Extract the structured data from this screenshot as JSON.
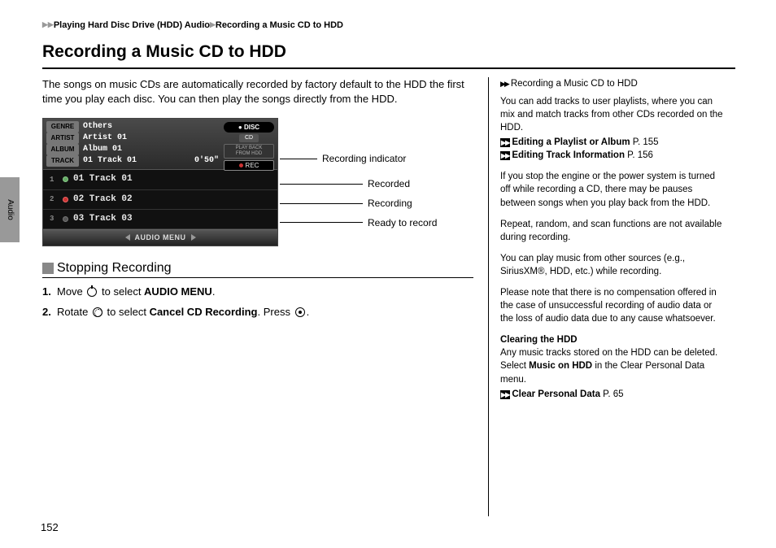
{
  "breadcrumb": {
    "part1": "Playing Hard Disc Drive (HDD) Audio",
    "part2": "Recording a Music CD to HDD"
  },
  "title": "Recording a Music CD to HDD",
  "intro": "The songs on music CDs are automatically recorded by factory default to the HDD the first time you play each disc. You can then play the songs directly from the HDD.",
  "screenshot": {
    "genre_label": "GENRE",
    "genre": "Others",
    "artist_label": "ARTIST",
    "artist": "Artist 01",
    "album_label": "ALBUM",
    "album": "Album 01",
    "track_label": "TRACK",
    "track": "01 Track 01",
    "time": "0'50\"",
    "disc": "DISC",
    "cd": "CD",
    "playback1": "PLAY BACK",
    "playback2": "FROM HDD",
    "rec": "REC",
    "tracks": [
      {
        "n": "1",
        "name": "01 Track 01",
        "state": "recorded"
      },
      {
        "n": "2",
        "name": "02 Track 02",
        "state": "recording"
      },
      {
        "n": "3",
        "name": "03 Track 03",
        "state": "ready"
      }
    ],
    "footer": "AUDIO MENU"
  },
  "callouts": {
    "c1": "Recording indicator",
    "c2": "Recorded",
    "c3": "Recording",
    "c4": "Ready to record"
  },
  "subheading": "Stopping Recording",
  "steps": {
    "s1a": "Move ",
    "s1b": " to select ",
    "s1c": "AUDIO MENU",
    "s1d": ".",
    "s2a": "Rotate ",
    "s2b": " to select ",
    "s2c": "Cancel CD Recording",
    "s2d": ". Press ",
    "s2e": "."
  },
  "sidebar": {
    "head": "Recording a Music CD to HDD",
    "p1": "You can add tracks to user playlists, where you can mix and match tracks from other CDs recorded on the HDD.",
    "xref1": "Editing a Playlist or Album",
    "xref1p": " P. 155",
    "xref2": "Editing Track Information",
    "xref2p": " P. 156",
    "p2": "If you stop the engine or the power system is turned off while recording a CD, there may be pauses between songs when you play back from the HDD.",
    "p3": "Repeat, random, and scan functions are not available during recording.",
    "p4": "You can play music from other sources (e.g., SiriusXM®, HDD, etc.) while recording.",
    "p5": "Please note that there is no compensation offered in the case of unsuccessful recording of audio data or the loss of audio data due to any cause whatsoever.",
    "clr_head": "Clearing the HDD",
    "clr_a": "Any music tracks stored on the HDD can be deleted. Select ",
    "clr_b": "Music on HDD",
    "clr_c": " in the Clear Personal Data menu.",
    "xref3": "Clear Personal Data",
    "xref3p": " P. 65"
  },
  "side_tab": "Audio",
  "page_number": "152"
}
